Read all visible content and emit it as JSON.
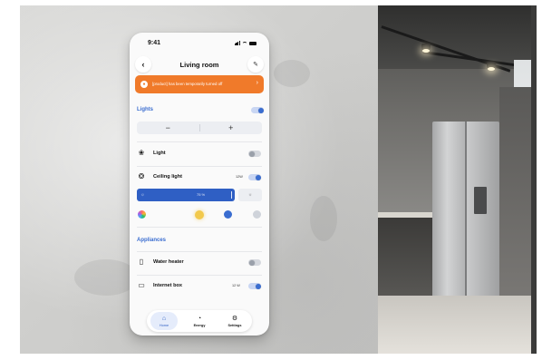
{
  "status_bar": {
    "time": "9:41"
  },
  "header": {
    "title": "Living room",
    "back_icon": "chevron-left-icon",
    "edit_icon": "pencil-icon"
  },
  "alert": {
    "text": "[product] has been temporarily turned off",
    "icon": "alert-icon",
    "color": "#f07a2a"
  },
  "lights": {
    "section_title": "Lights",
    "section_toggle_on": true,
    "stepper": {
      "minus": "−",
      "plus": "+"
    },
    "items": [
      {
        "label": "Light",
        "icon": "bulb-icon",
        "on": false
      },
      {
        "label": "Ceiling light",
        "icon": "bulb-icon",
        "value": "12W",
        "on": true
      }
    ],
    "dimmer": {
      "value_label": "75 %",
      "level_percent": 75
    },
    "colors": [
      "#f2c94c",
      "#3a6dd0",
      "#9aa0aa"
    ]
  },
  "appliances": {
    "section_title": "Appliances",
    "items": [
      {
        "label": "Water heater",
        "icon": "water-heater-icon",
        "on": false
      },
      {
        "label": "Internet box",
        "icon": "router-icon",
        "value": "12 W",
        "on": true
      }
    ]
  },
  "tabs": [
    {
      "label": "Home",
      "icon": "home-icon",
      "active": true
    },
    {
      "label": "Energy",
      "icon": "gauge-icon",
      "active": false
    },
    {
      "label": "Settings",
      "icon": "gear-icon",
      "active": false
    }
  ],
  "colors": {
    "accent": "#3a6dd0",
    "alert": "#f07a2a"
  }
}
